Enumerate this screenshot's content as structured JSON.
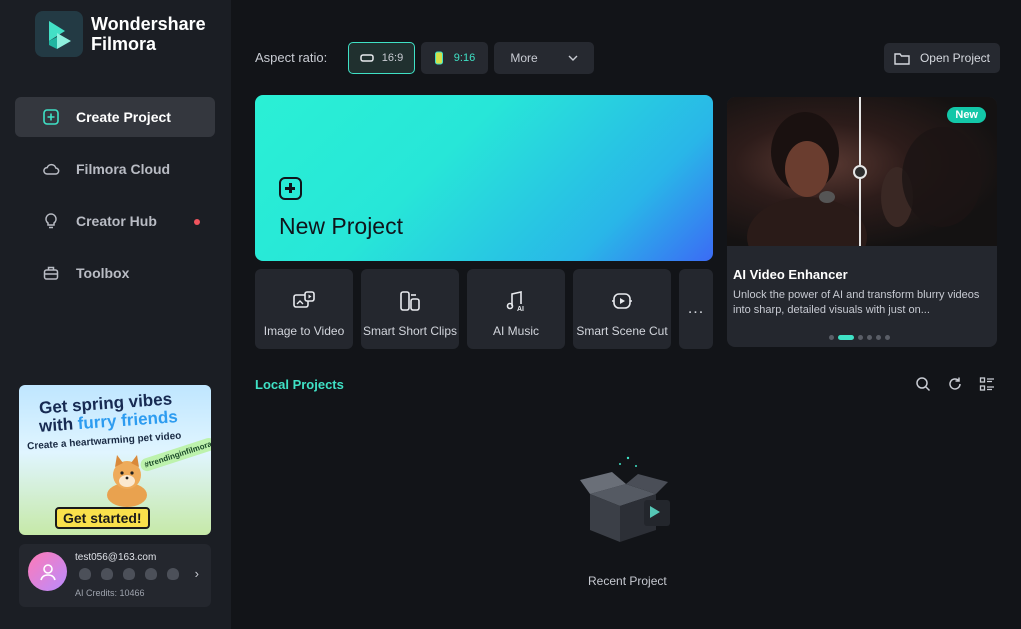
{
  "app": {
    "name_line1": "Wondershare",
    "name_line2": "Filmora"
  },
  "sidebar": {
    "items": [
      {
        "label": "Create Project",
        "icon": "add-square-icon",
        "active": true
      },
      {
        "label": "Filmora Cloud",
        "icon": "cloud-icon",
        "active": false
      },
      {
        "label": "Creator Hub",
        "icon": "lightbulb-icon",
        "active": false,
        "notification": true
      },
      {
        "label": "Toolbox",
        "icon": "toolbox-icon",
        "active": false
      }
    ],
    "promo": {
      "line1": "Get spring vibes",
      "line2_prefix": "with ",
      "line2_highlight": "furry friends",
      "line3": "Create a heartwarming pet video",
      "tag": "#trendinginfilmora",
      "cta": "Get started!"
    },
    "account": {
      "email": "test056@163.com",
      "credits": "AI Credits: 10466"
    }
  },
  "toolbar": {
    "aspect_label": "Aspect ratio:",
    "ratio_169": "16:9",
    "ratio_916": "9:16",
    "more_label": "More",
    "open_project": "Open Project"
  },
  "new_project": {
    "label": "New Project"
  },
  "tools": [
    {
      "label": "Image to Video",
      "icon": "image-to-video-icon"
    },
    {
      "label": "Smart Short Clips",
      "icon": "smart-short-clips-icon"
    },
    {
      "label": "AI Music",
      "icon": "ai-music-icon"
    },
    {
      "label": "Smart Scene Cut",
      "icon": "smart-scene-cut-icon"
    }
  ],
  "tools_more": "...",
  "feature": {
    "badge": "New",
    "title": "AI Video Enhancer",
    "description": "Unlock the power of AI and transform blurry videos into sharp, detailed visuals with just on..."
  },
  "local_projects": {
    "title": "Local Projects",
    "empty_label": "Recent Project"
  },
  "colors": {
    "accent": "#3fe1c5",
    "background": "#121418",
    "sidebar": "#1b1e24",
    "notification": "#f0545e"
  }
}
